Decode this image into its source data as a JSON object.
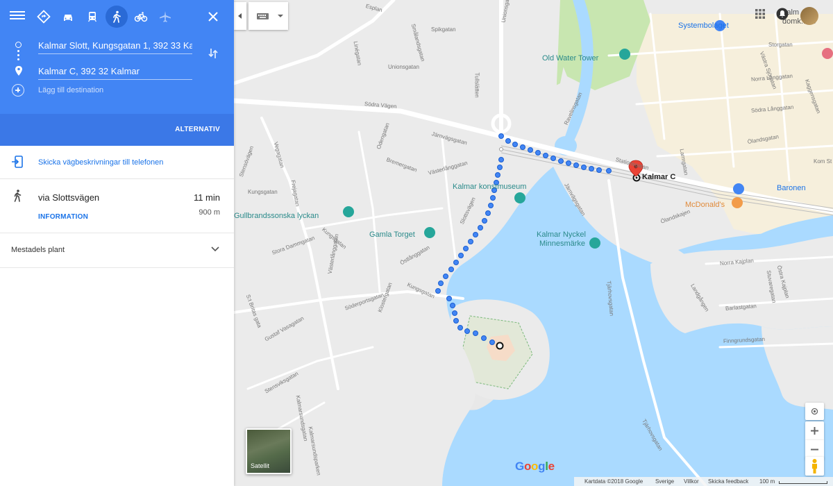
{
  "travel_modes": [
    {
      "name": "best",
      "active": false
    },
    {
      "name": "driving",
      "active": false
    },
    {
      "name": "transit",
      "active": false
    },
    {
      "name": "walking",
      "active": true
    },
    {
      "name": "cycling",
      "active": false
    },
    {
      "name": "flight",
      "active": false
    }
  ],
  "route": {
    "origin_value": "Kalmar Slott, Kungsgatan 1, 392 33 Kalmar",
    "destination_value": "Kalmar C, 392 32 Kalmar",
    "add_destination": "Lägg till destination",
    "options_label": "ALTERNATIV"
  },
  "send": {
    "label": "Skicka vägbeskrivningar till telefonen"
  },
  "result": {
    "via": "via Slottsvägen",
    "time": "11 min",
    "distance": "900 m",
    "details_label": "INFORMATION"
  },
  "terrain": {
    "label": "Mestadels plant"
  },
  "map": {
    "places": {
      "systembolaget": "Systembolaget",
      "old_water_tower": "Old Water Tower",
      "kalmar_c": "Kalmar C",
      "baronen": "Baronen",
      "mcdonalds": "McDonald's",
      "konstmuseum": "Kalmar konstmuseum",
      "gullbrandsonska": "Gullbrandssonska lyckan",
      "gamla_torget": "Gamla Torget",
      "kalmar_nyckel_1": "Kalmar Nyckel",
      "kalmar_nyckel_2": "Minnesmärke",
      "kalmar_domkyrka": "Kalm",
      "domkyrka_2": "domk.förs"
    },
    "streets": {
      "esplanaden": "Esplan",
      "spikgatan": "Spikgatan",
      "unionsgatan1": "Unionsgatan",
      "unionsgatan2": "Unionsgatan",
      "smalandsgatan": "Smålandsgatan",
      "linegatan": "Linégatan",
      "tullslatten": "Tullslätten",
      "sodra_vagen": "Södra Vägen",
      "jarnvagsgatan": "Järnvägsgatan",
      "vastgatan": "Vegagatan",
      "odengatan": "Odengatan",
      "bremergatan": "Bremergatan",
      "vasterlanggatan": "Västerlånggatan",
      "stensovagen": "Stensövägen",
      "kungsgatan": "Kungsgatan",
      "frejagatan": "Frejagatan",
      "ravelinsgatan": "Ravelinsgatan",
      "stationsgatan": "Stationsgatan",
      "jarnvagsgatan2": "Järnvägsgatan",
      "stora_dammgatan": "Stora Dammgatan",
      "kungsgatan2": "Kungsgatan",
      "ostlanggatan": "Östlånggatan",
      "vasterlanggatan2": "Västerlånggatan",
      "kungsgatan3": "Kungsgatan",
      "st_britas": "S:t Britas gata",
      "sodra_portgatan": "Söderportsgatan",
      "klostergatan": "Klostergatan",
      "gustaf_vasagatan": "Gustaf Vasagatan",
      "stensviksgatan": "Stensviksgatan",
      "kalmarsundsgatan": "Kalmarsundsgatan",
      "kalmarsundsparken": "Kalmarsundsparken",
      "tjarhovsgatan": "Tjärhovsgatan",
      "tjarhovsgatan2": "Tjärhovsgatan",
      "olandskajen": "Ölandskajen",
      "norra_kajplan": "Norra Kajplan",
      "ostra_kajplan": "Östra Kajplan",
      "landgangen": "Landgången",
      "barlastgatan": "Barlastgatan",
      "stuvaregatan": "Stuvaregatan",
      "finngrundsgatan": "Finngrundsgatan",
      "olandsgatan": "Ölandsgatan",
      "lanngatan": "Larmgatan",
      "norra_langgatan": "Norra Långgatan",
      "sodra_langgatan": "Södra Långgatan",
      "vastra_sjogatan": "Västra Sjögatan",
      "kaggensgatan": "Kaggensgatan",
      "storgatan": "Storgatan",
      "kom_st": "Kom St",
      "slottsvagen": "Slottsvägen"
    },
    "satellite_label": "Satellit",
    "google_logo": [
      "G",
      "o",
      "o",
      "g",
      "l",
      "e"
    ],
    "footer": {
      "copyright": "Kartdata ©2018 Google",
      "country": "Sverige",
      "terms": "Villkor",
      "feedback": "Skicka feedback",
      "scale": "100 m"
    }
  },
  "colors": {
    "header_blue": "#4285f4",
    "link_blue": "#1a73e8",
    "water": "#aadaff",
    "park": "#c8e6b0",
    "route_dot": "#4285f4",
    "pin_red": "#ea4335"
  }
}
